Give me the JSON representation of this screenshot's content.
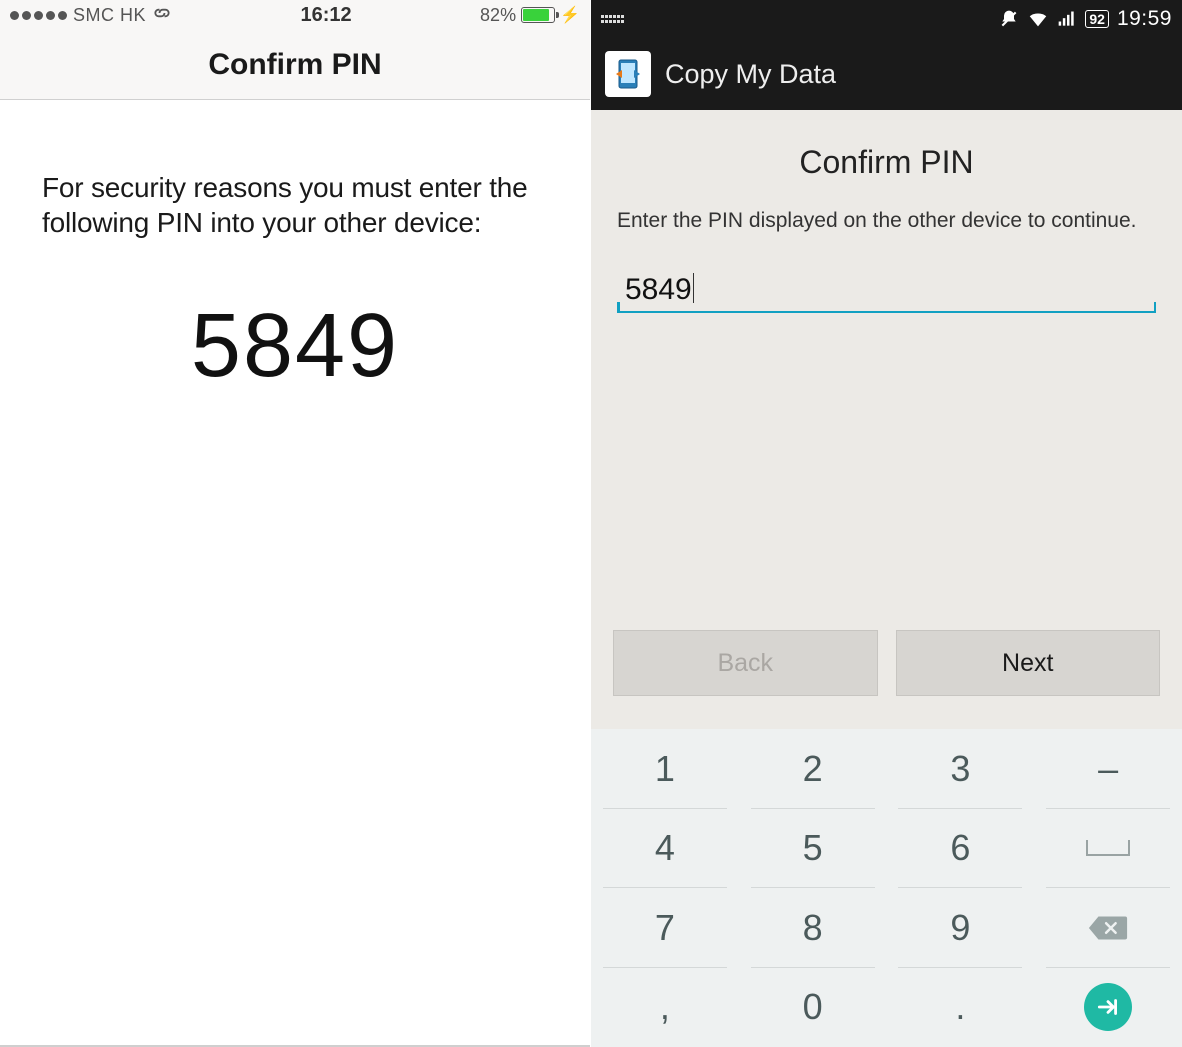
{
  "left": {
    "statusbar": {
      "carrier": "SMC HK",
      "time": "16:12",
      "battery_percent": "82%"
    },
    "nav_title": "Confirm PIN",
    "message": "For security reasons you must enter the following PIN into your other device:",
    "pin": "5849"
  },
  "right": {
    "statusbar": {
      "battery_level": "92",
      "time": "19:59"
    },
    "app_title": "Copy My Data",
    "heading": "Confirm PIN",
    "subtext": "Enter the PIN displayed on the other device to continue.",
    "input_value": "5849",
    "buttons": {
      "back": "Back",
      "next": "Next"
    },
    "keypad": {
      "k1": "1",
      "k2": "2",
      "k3": "3",
      "dash": "–",
      "k4": "4",
      "k5": "5",
      "k6": "6",
      "k7": "7",
      "k8": "8",
      "k9": "9",
      "comma": ",",
      "k0": "0",
      "dot": "."
    }
  }
}
